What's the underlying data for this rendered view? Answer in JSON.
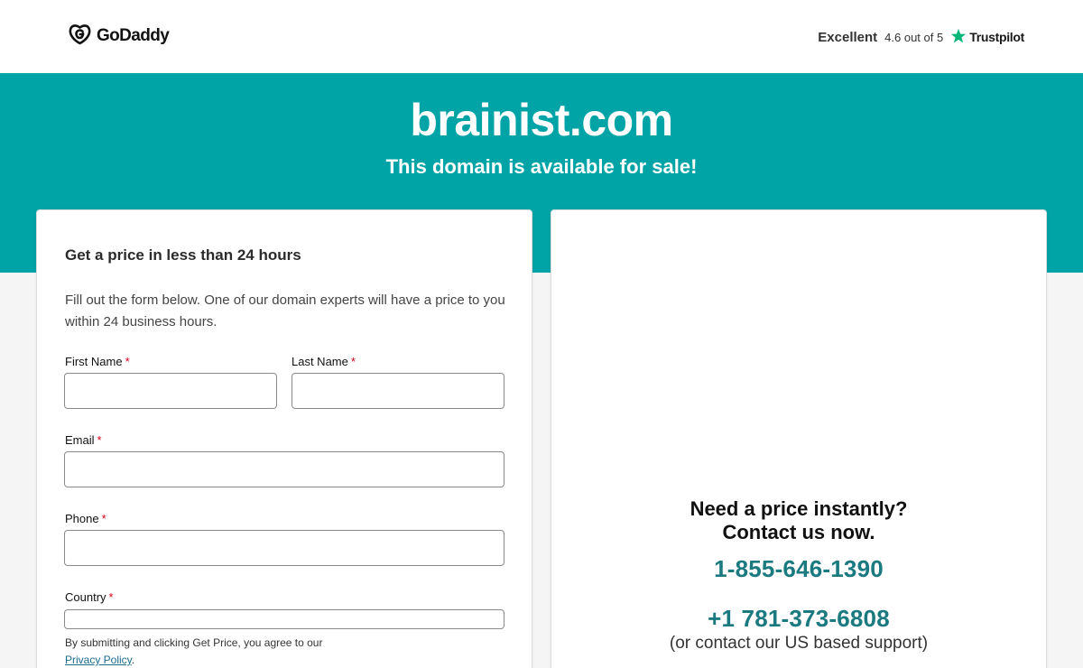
{
  "header": {
    "brand": "GoDaddy",
    "trust_label": "Excellent",
    "trust_score": "4.6 out of 5",
    "trust_provider": "Trustpilot"
  },
  "hero": {
    "domain": "brainist.com",
    "subtitle": "This domain is available for sale!"
  },
  "form": {
    "title": "Get a price in less than 24 hours",
    "description": "Fill out the form below. One of our domain experts will have a price to you within 24 business hours.",
    "required_mark": "*",
    "fields": {
      "first_name": {
        "label": "First Name",
        "value": "",
        "placeholder": ""
      },
      "last_name": {
        "label": "Last Name",
        "value": "",
        "placeholder": ""
      },
      "email": {
        "label": "Email",
        "value": "",
        "placeholder": ""
      },
      "phone": {
        "label": "Phone",
        "value": "",
        "placeholder": ""
      },
      "country": {
        "label": "Country",
        "value": ""
      }
    },
    "terms_text": "By submitting and clicking Get Price, you agree to our",
    "privacy_link": "Privacy Policy",
    "privacy_suffix": "."
  },
  "contact": {
    "heading_line1": "Need a price instantly?",
    "heading_line2": "Contact us now.",
    "phone_1": "1-855-646-1390",
    "phone_2": "+1 781-373-6808",
    "support_note": "(or contact our US based support)"
  },
  "colors": {
    "hero_bg": "#00a4a6",
    "phone_color": "#1a7a80",
    "required_color": "#d6001c",
    "trustpilot_green": "#00b67a"
  }
}
